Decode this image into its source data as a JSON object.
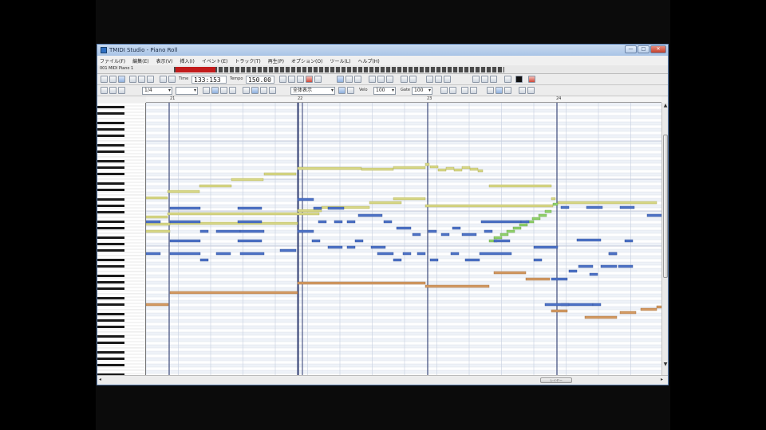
{
  "window": {
    "title": "TMIDI Studio - Piano Roll",
    "subtitle": "",
    "buttons": {
      "minimize": "—",
      "maximize": "□",
      "close": "✕"
    }
  },
  "menu": [
    "ファイル(F)",
    "編集(E)",
    "表示(V)",
    "挿入(I)",
    "イベント(E)",
    "トラック(T)",
    "再生(P)",
    "オプション(O)",
    "ツール(L)",
    "ヘルプ(H)"
  ],
  "track": {
    "name": "001 MIDI Piano 1"
  },
  "transport": {
    "position_label": "Time",
    "position": "133:153",
    "tempo_label": "Tempo",
    "tempo": "150.00"
  },
  "toolbar2": {
    "snap_value": "1/4",
    "quantize_value": "全体表示",
    "vel_label": "Velo",
    "vel_value": "100",
    "len_label": "Gate",
    "len_value": "100"
  },
  "ruler": {
    "bars": [
      "21",
      "22",
      "23",
      "24"
    ]
  },
  "scroll": {
    "h_label": "レイヤー"
  },
  "colors": {
    "note_blue": "#4d72c6",
    "note_yellow": "#d7d786",
    "note_orange": "#d49a62",
    "note_green": "#8fd06a",
    "grid_line": "#d6dbe6",
    "bar_line": "#3d4a7a"
  },
  "notes": {
    "yellow": [
      [
        0,
        118,
        27
      ],
      [
        27,
        110,
        40
      ],
      [
        67,
        103,
        40
      ],
      [
        107,
        95,
        40
      ],
      [
        148,
        88,
        40
      ],
      [
        190,
        81,
        80
      ],
      [
        270,
        82,
        40
      ],
      [
        310,
        80,
        40
      ],
      [
        350,
        76,
        5
      ],
      [
        356,
        79,
        10
      ],
      [
        366,
        83,
        10
      ],
      [
        376,
        81,
        10
      ],
      [
        386,
        83,
        10
      ],
      [
        396,
        80,
        10
      ],
      [
        406,
        82,
        10
      ],
      [
        416,
        84,
        6
      ],
      [
        430,
        103,
        78
      ],
      [
        508,
        119,
        5
      ],
      [
        516,
        124,
        124
      ],
      [
        0,
        142,
        27
      ],
      [
        27,
        138,
        190
      ],
      [
        190,
        134,
        30
      ],
      [
        220,
        130,
        60
      ],
      [
        280,
        124,
        40
      ],
      [
        310,
        119,
        40
      ],
      [
        350,
        128,
        160
      ],
      [
        0,
        151,
        30
      ],
      [
        0,
        160,
        30
      ],
      [
        30,
        150,
        160
      ]
    ],
    "green": [
      [
        430,
        172,
        10
      ],
      [
        436,
        168,
        10
      ],
      [
        444,
        164,
        10
      ],
      [
        452,
        160,
        10
      ],
      [
        460,
        156,
        10
      ],
      [
        468,
        152,
        10
      ],
      [
        476,
        148,
        10
      ],
      [
        484,
        144,
        10
      ],
      [
        492,
        140,
        10
      ],
      [
        500,
        135,
        8
      ],
      [
        510,
        126,
        6
      ]
    ],
    "blue": [
      [
        0,
        148,
        18
      ],
      [
        30,
        131,
        38
      ],
      [
        30,
        148,
        38
      ],
      [
        30,
        172,
        38
      ],
      [
        0,
        188,
        18
      ],
      [
        30,
        188,
        38
      ],
      [
        115,
        131,
        30
      ],
      [
        115,
        148,
        30
      ],
      [
        115,
        172,
        30
      ],
      [
        168,
        184,
        20
      ],
      [
        68,
        160,
        10
      ],
      [
        88,
        160,
        30
      ],
      [
        118,
        160,
        30
      ],
      [
        68,
        196,
        10
      ],
      [
        88,
        188,
        18
      ],
      [
        118,
        188,
        30
      ],
      [
        190,
        120,
        20
      ],
      [
        210,
        131,
        10
      ],
      [
        228,
        131,
        20
      ],
      [
        216,
        148,
        10
      ],
      [
        236,
        148,
        10
      ],
      [
        190,
        160,
        20
      ],
      [
        208,
        172,
        10
      ],
      [
        228,
        180,
        18
      ],
      [
        252,
        180,
        10
      ],
      [
        262,
        172,
        10
      ],
      [
        282,
        180,
        18
      ],
      [
        252,
        148,
        10
      ],
      [
        266,
        140,
        30
      ],
      [
        298,
        148,
        10
      ],
      [
        314,
        156,
        18
      ],
      [
        334,
        164,
        10
      ],
      [
        354,
        160,
        10
      ],
      [
        370,
        164,
        10
      ],
      [
        384,
        156,
        10
      ],
      [
        396,
        164,
        18
      ],
      [
        420,
        148,
        50
      ],
      [
        424,
        160,
        10
      ],
      [
        436,
        172,
        20
      ],
      [
        470,
        148,
        10
      ],
      [
        486,
        180,
        30
      ],
      [
        340,
        188,
        10
      ],
      [
        356,
        196,
        10
      ],
      [
        382,
        188,
        10
      ],
      [
        400,
        196,
        18
      ],
      [
        290,
        188,
        20
      ],
      [
        310,
        196,
        10
      ],
      [
        322,
        188,
        10
      ],
      [
        418,
        188,
        40
      ],
      [
        508,
        220,
        20
      ],
      [
        486,
        196,
        10
      ],
      [
        530,
        210,
        10
      ],
      [
        542,
        204,
        18
      ],
      [
        556,
        214,
        10
      ],
      [
        570,
        204,
        20
      ],
      [
        580,
        188,
        10
      ],
      [
        592,
        204,
        18
      ],
      [
        540,
        171,
        30
      ],
      [
        600,
        172,
        10
      ],
      [
        580,
        188,
        10
      ],
      [
        520,
        130,
        10
      ],
      [
        552,
        130,
        20
      ],
      [
        594,
        130,
        18
      ],
      [
        628,
        140,
        18
      ],
      [
        520,
        252,
        40
      ],
      [
        500,
        252,
        30
      ],
      [
        560,
        252,
        10
      ]
    ],
    "orange": [
      [
        0,
        252,
        28
      ],
      [
        30,
        237,
        160
      ],
      [
        190,
        225,
        160
      ],
      [
        350,
        229,
        80
      ],
      [
        436,
        212,
        40
      ],
      [
        476,
        220,
        30
      ],
      [
        550,
        268,
        40
      ],
      [
        594,
        262,
        20
      ],
      [
        620,
        258,
        20
      ],
      [
        640,
        255,
        6
      ],
      [
        508,
        260,
        20
      ]
    ]
  }
}
